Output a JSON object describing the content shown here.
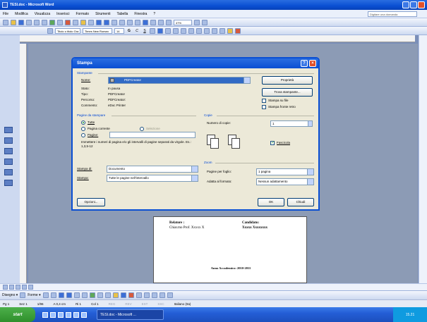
{
  "window": {
    "title": "TESI.doc - Microsoft Word"
  },
  "menu": {
    "items": [
      "File",
      "Modifica",
      "Visualizza",
      "Inserisci",
      "Formato",
      "Strumenti",
      "Tabella",
      "Finestra",
      "?"
    ],
    "help_placeholder": "Digitare una domanda"
  },
  "toolbar": {
    "zoom": "47%",
    "style": "Titolo o titolo Gra",
    "font": "Times New Roman",
    "size": "14",
    "bold": "G",
    "italic": "C",
    "underline": "S"
  },
  "dialog": {
    "title": "Stampa",
    "printer_group": "Stampante",
    "name_label": "Nome:",
    "name_value": "PDFCreator",
    "status_label": "Stato:",
    "status_value": "In pausa",
    "type_label": "Tipo:",
    "type_value": "PDFCreator",
    "path_label": "Percorso:",
    "path_value": "PDFCreator:",
    "comment_label": "Commento:",
    "comment_value": "eDoc Printer",
    "properties_btn": "Proprietà",
    "find_printer_btn": "Trova stampante...",
    "print_to_file": "Stampa su file",
    "manual_duplex": "Stampa fronte retro",
    "pages_group": "Pagine da stampare",
    "all": "Tutte",
    "current_page": "Pagina corrente",
    "selection": "Selezione",
    "pages": "Pagine:",
    "pages_hint": "Immettere i numeri di pagina e/o gli intervalli di pagine separati da virgole. Es.: 1,3,5-12",
    "copies_group": "Copie",
    "copies_label": "Numero di copie:",
    "copies_value": "1",
    "collate": "Fascicola",
    "print_what_label": "Stampa di:",
    "print_what_value": "Documento",
    "print_label": "Stampa:",
    "print_value": "Tutte le pagine nell'intervallo",
    "zoom_group": "Zoom",
    "pages_per_sheet_label": "Pagine per foglio:",
    "pages_per_sheet_value": "1 pagina",
    "scale_label": "Adatta al formato:",
    "scale_value": "Nessun adattamento",
    "options_btn": "Opzioni...",
    "ok_btn": "OK",
    "close_btn": "Chiudi"
  },
  "document": {
    "relatore_label": "Relatore :",
    "relatore_name": "Chiar.mo Prof. Xxxxx X",
    "candidato_label": "Candidato:",
    "candidato_name": "Xxxxx  Xxxxxxxx",
    "year": "Anno Accademico:  2010-2011"
  },
  "drawbar": {
    "draw": "Disegno ▾",
    "shapes": "Forme ▾"
  },
  "status": {
    "page": "Pg 1",
    "section": "Sez 1",
    "position": "1/96",
    "at": "A 0,4 cm",
    "row": "Ri 1",
    "col": "Col 1",
    "rec": "REG",
    "rev": "REV",
    "ext": "EST",
    "ovr": "SSC",
    "lang": "Italiano (Ita)"
  },
  "taskbar": {
    "start": "start",
    "task": "TESI.doc - Microsoft ...",
    "clock": "15.21"
  }
}
